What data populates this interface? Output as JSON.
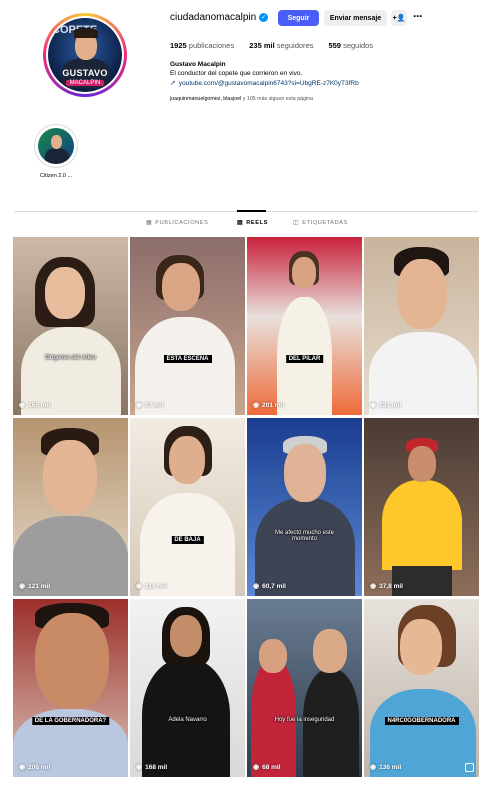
{
  "profile": {
    "username": "ciudadanomacalpin",
    "verified_icon": "verified-badge-icon",
    "follow_label": "Seguir",
    "message_label": "Enviar mensaje",
    "add_user_icon": "+Я",
    "more_icon": "···",
    "stats": {
      "posts_value": "1925",
      "posts_label": "publicaciones",
      "followers_value": "235 mil",
      "followers_label": "seguidores",
      "following_value": "559",
      "following_label": "seguidos"
    },
    "full_name": "Gustavo Macalpin",
    "bio": "El conductor del copete que corrieron en vivo.",
    "link": "youtube.com/@gustavomacalpin6743?si=UbgRE-z7K0yT3fRb",
    "followed_by_names": "joaquinmanuelgomez, blasjoel",
    "followed_by_rest": "y 105 más siguen esta página",
    "avatar_text_top": "COPETE",
    "avatar_name": "GUSTAVO",
    "avatar_sub": "MACALPIN",
    "accent_color": "#4a5df9"
  },
  "highlight": {
    "label": "Citizen 2.0 ..."
  },
  "tabs": [
    {
      "label": "PUBLICACIONES",
      "icon": "▦"
    },
    {
      "label": "REELS",
      "icon": "▤"
    },
    {
      "label": "ETIQUETADAS",
      "icon": "◫"
    }
  ],
  "reels": [
    {
      "views": "165 mil",
      "caption": "Orígenes del vídeo"
    },
    {
      "views": "57 mil",
      "caption": "ESTA ESCENA"
    },
    {
      "views": "201 mil",
      "caption": "DEL PILAR"
    },
    {
      "views": "131 mil",
      "caption": ""
    },
    {
      "views": "121 mil",
      "caption": ""
    },
    {
      "views": "114 mil",
      "caption": "DE BAJA"
    },
    {
      "views": "60,7 mil",
      "caption": "Me afectó mucho este momento"
    },
    {
      "views": "37,8 mil",
      "caption": ""
    },
    {
      "views": "206 mil",
      "caption": "DE LA GOBERNADORA?"
    },
    {
      "views": "168 mil",
      "caption": "Adela Navarro"
    },
    {
      "views": "68 mil",
      "caption": "Hoy fue la inseguridad"
    },
    {
      "views": "136 mil",
      "caption": "N4RC0GOBERNADORA"
    }
  ]
}
